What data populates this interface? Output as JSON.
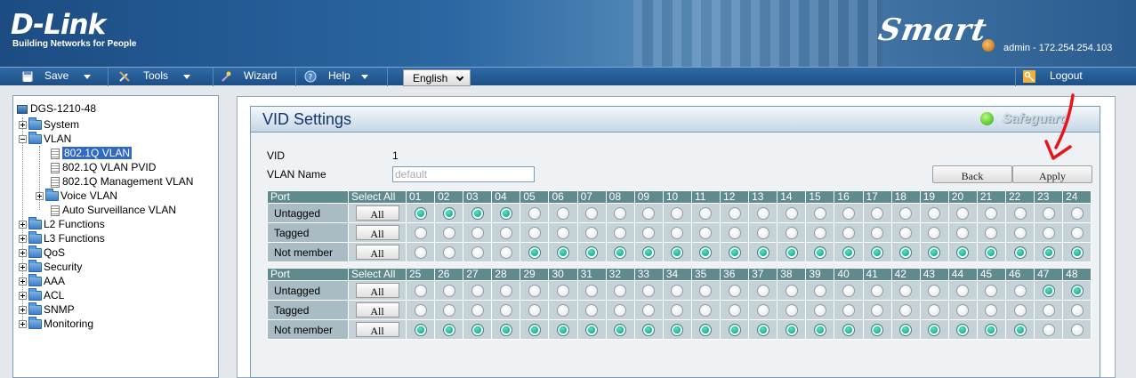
{
  "header": {
    "brand": "D-Link",
    "tagline": "Building Networks for People",
    "product_logo": "Smart",
    "user_info": "admin - 172.254.254.103"
  },
  "menu": {
    "save": "Save",
    "tools": "Tools",
    "wizard": "Wizard",
    "help": "Help",
    "language": "English",
    "logout": "Logout"
  },
  "tree": {
    "root": "DGS-1210-48",
    "items": {
      "system": "System",
      "vlan": "VLAN",
      "dot1q_vlan": "802.1Q VLAN",
      "dot1q_pvid": "802.1Q VLAN PVID",
      "dot1q_mgmt": "802.1Q Management VLAN",
      "voice_vlan": "Voice VLAN",
      "auto_surv": "Auto Surveillance VLAN",
      "l2": "L2 Functions",
      "l3": "L3 Functions",
      "qos": "QoS",
      "security": "Security",
      "aaa": "AAA",
      "acl": "ACL",
      "snmp": "SNMP",
      "monitoring": "Monitoring"
    }
  },
  "panel": {
    "title": "VID Settings",
    "safeguard": "Safeguard",
    "vid_label": "VID",
    "vid_value": "1",
    "vlan_name_label": "VLAN Name",
    "vlan_name_placeholder": "default",
    "back_label": "Back",
    "apply_label": "Apply"
  },
  "port_table": {
    "port_header": "Port",
    "select_all_header": "Select All",
    "all_label": "All",
    "row_labels": [
      "Untagged",
      "Tagged",
      "Not member"
    ],
    "groups": [
      {
        "ports": [
          "01",
          "02",
          "03",
          "04",
          "05",
          "06",
          "07",
          "08",
          "09",
          "10",
          "11",
          "12",
          "13",
          "14",
          "15",
          "16",
          "17",
          "18",
          "19",
          "20",
          "21",
          "22",
          "23",
          "24"
        ],
        "membership": [
          "U",
          "U",
          "U",
          "U",
          "N",
          "N",
          "N",
          "N",
          "N",
          "N",
          "N",
          "N",
          "N",
          "N",
          "N",
          "N",
          "N",
          "N",
          "N",
          "N",
          "N",
          "N",
          "N",
          "N"
        ]
      },
      {
        "ports": [
          "25",
          "26",
          "27",
          "28",
          "29",
          "30",
          "31",
          "32",
          "33",
          "34",
          "35",
          "36",
          "37",
          "38",
          "39",
          "40",
          "41",
          "42",
          "43",
          "44",
          "45",
          "46",
          "47",
          "48"
        ],
        "membership": [
          "N",
          "N",
          "N",
          "N",
          "N",
          "N",
          "N",
          "N",
          "N",
          "N",
          "N",
          "N",
          "N",
          "N",
          "N",
          "N",
          "N",
          "N",
          "N",
          "N",
          "N",
          "N",
          "U",
          "U"
        ]
      }
    ]
  },
  "colors": {
    "header_blue": "#1c4c82",
    "table_header": "#5f8a8e",
    "radio_selected": "#0b9c80",
    "annotation_arrow": "#e8141a",
    "safeguard_green": "#2fa313"
  }
}
